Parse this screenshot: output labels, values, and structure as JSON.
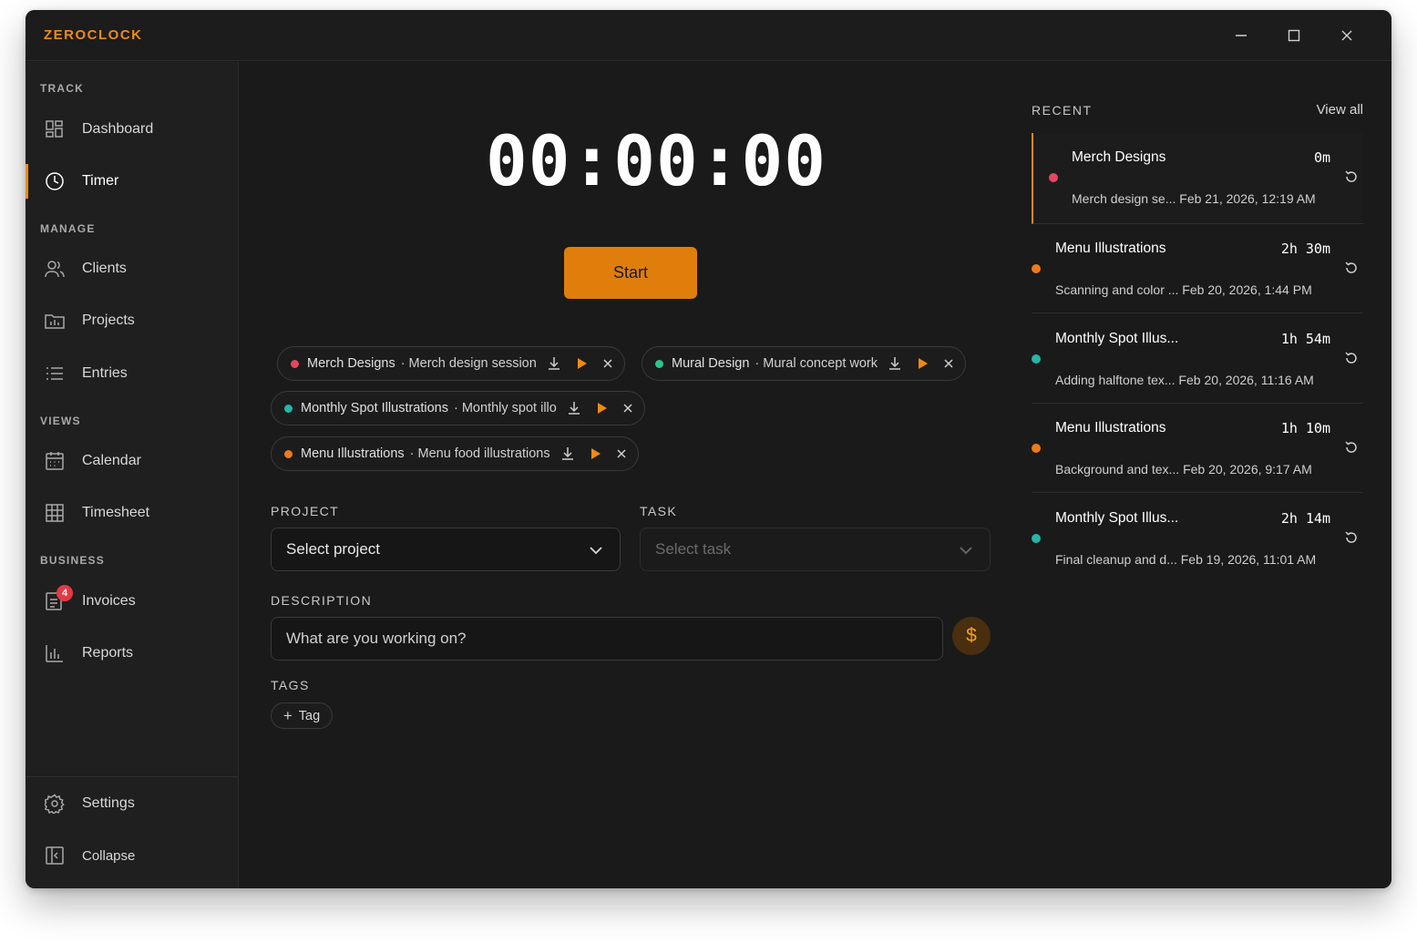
{
  "app": {
    "title": "ZEROCLOCK"
  },
  "sidebar": {
    "sections": {
      "track": "TRACK",
      "manage": "MANAGE",
      "views": "VIEWS",
      "business": "BUSINESS"
    },
    "items": {
      "dashboard": "Dashboard",
      "timer": "Timer",
      "clients": "Clients",
      "projects": "Projects",
      "entries": "Entries",
      "calendar": "Calendar",
      "timesheet": "Timesheet",
      "invoices": "Invoices",
      "reports": "Reports",
      "settings": "Settings",
      "collapse": "Collapse"
    },
    "invoices_badge": "4",
    "active_item": "timer"
  },
  "timer": {
    "display": "00:00:00",
    "start_label": "Start"
  },
  "quick_starts": [
    {
      "project": "Merch Designs",
      "task": "· Merch design session",
      "color": "#e84560"
    },
    {
      "project": "Mural Design",
      "task": "· Mural concept work",
      "color": "#2ec48a"
    },
    {
      "project": "Monthly Spot Illustrations",
      "task": "· Monthly spot illo",
      "color": "#26b5a8"
    },
    {
      "project": "Menu Illustrations",
      "task": "· Menu food illustrations",
      "color": "#f07a1a"
    }
  ],
  "form": {
    "project_label": "PROJECT",
    "project_placeholder": "Select project",
    "task_label": "TASK",
    "task_placeholder": "Select task",
    "description_label": "DESCRIPTION",
    "description_placeholder": "What are you working on?",
    "billable_symbol": "$",
    "tags_label": "TAGS",
    "add_tag_label": "Tag"
  },
  "recent": {
    "label": "RECENT",
    "view_all": "View all",
    "items": [
      {
        "title": "Merch Designs",
        "duration": "0m",
        "meta": "Merch design se... Feb 21, 2026, 12:19 AM",
        "color": "#e84560",
        "active": true
      },
      {
        "title": "Menu Illustrations",
        "duration": "2h 30m",
        "meta": "Scanning and color ... Feb 20, 2026, 1:44 PM",
        "color": "#f07a1a",
        "active": false
      },
      {
        "title": "Monthly Spot Illus...",
        "duration": "1h 54m",
        "meta": "Adding halftone tex... Feb 20, 2026, 11:16 AM",
        "color": "#26b5a8",
        "active": false
      },
      {
        "title": "Menu Illustrations",
        "duration": "1h 10m",
        "meta": "Background and tex... Feb 20, 2026, 9:17 AM",
        "color": "#f07a1a",
        "active": false
      },
      {
        "title": "Monthly Spot Illus...",
        "duration": "2h 14m",
        "meta": "Final cleanup and d... Feb 19, 2026, 11:01 AM",
        "color": "#26b5a8",
        "active": false
      }
    ]
  },
  "colors": {
    "accent": "#f08a12",
    "start_button": "#e07e0c",
    "badge": "#e53945"
  }
}
